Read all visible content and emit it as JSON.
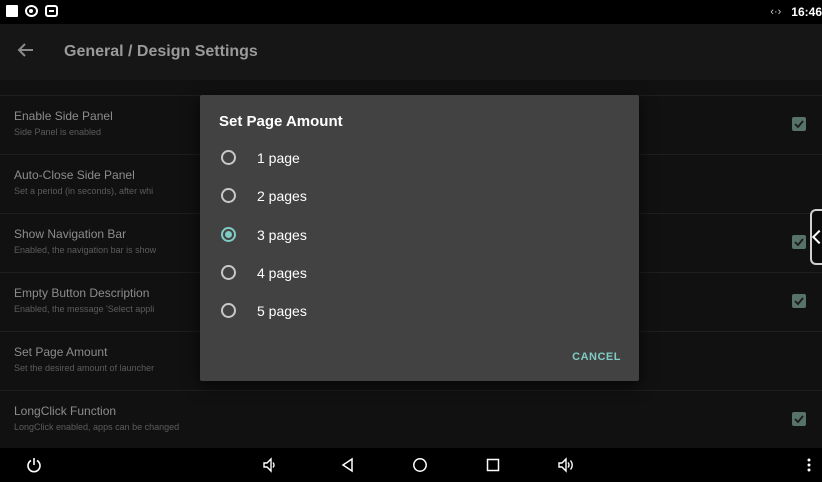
{
  "status_bar": {
    "time": "16:46",
    "network": "‹·›"
  },
  "app_bar": {
    "title": "General / Design Settings"
  },
  "settings": [
    {
      "title": "Enable Side Panel",
      "subtitle": "Side Panel is enabled",
      "checked": true
    },
    {
      "title": "Auto-Close Side Panel",
      "subtitle": "Set a period (in seconds), after whi",
      "checked": false
    },
    {
      "title": "Show Navigation Bar",
      "subtitle": "Enabled, the navigation bar is show",
      "checked": true
    },
    {
      "title": "Empty Button Description",
      "subtitle": "Enabled, the message 'Select appli",
      "checked": true
    },
    {
      "title": "Set Page Amount",
      "subtitle": "Set the desired amount of launcher",
      "checked": false
    },
    {
      "title": "LongClick Function",
      "subtitle": "LongClick enabled, apps can be changed",
      "checked": true
    }
  ],
  "dialog": {
    "title": "Set Page Amount",
    "options": [
      {
        "label": "1 page",
        "selected": false
      },
      {
        "label": "2 pages",
        "selected": false
      },
      {
        "label": "3 pages",
        "selected": true
      },
      {
        "label": "4 pages",
        "selected": false
      },
      {
        "label": "5 pages",
        "selected": false
      }
    ],
    "cancel_label": "CANCEL"
  },
  "colors": {
    "accent": "#80cbc4",
    "dialog_bg": "#424242",
    "checkbox": "#57726b"
  },
  "nav_bar": {
    "icons": [
      "power-icon",
      "volume-down-icon",
      "back-icon",
      "home-icon",
      "recents-icon",
      "volume-up-icon",
      "more-icon"
    ]
  }
}
